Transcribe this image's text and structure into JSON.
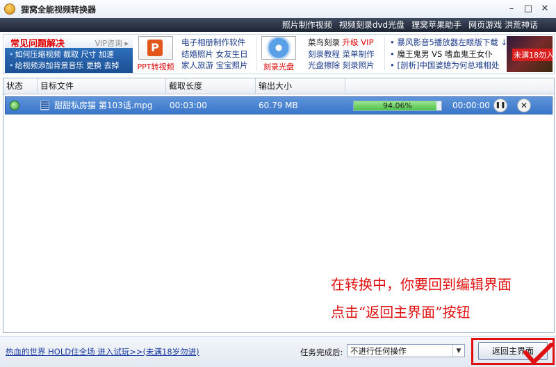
{
  "window": {
    "title": "狸窝全能视频转换器",
    "controls": [
      "–",
      "□",
      "✕"
    ]
  },
  "top_menu": [
    "照片制作视频",
    "视频刻录dvd光盘",
    "狸窝苹果助手",
    "网页游戏 洪荒神话"
  ],
  "banner": {
    "faq_title": "常见问题解决",
    "faq_vip": "VIP咨询 ▸",
    "faq_line1": "如何压缩视频 截取 尺寸 加速",
    "faq_line2": "给视频添加背景音乐 更换 去掉",
    "ppt_caption": "PPT转视频",
    "col1": [
      "电子相册制作软件",
      "结婚照片 女友生日",
      "家人旅游 宝宝照片"
    ],
    "disc_caption": "刻录光盘",
    "col2_line1_a": "菜鸟刻录",
    "col2_line1_b": "升级 VIP",
    "col2_line2": "刻录教程 菜单制作",
    "col2_line3": "光盘擦除 刻录照片",
    "col3_line1": "暴风影音5播放器左眼版下载 ↓",
    "col3_line2": "魔王鬼男 VS 嗜血鬼王女仆",
    "col3_line3": "[剖析]中国婆媳为何总难相处",
    "game_tag": "未满18勿入"
  },
  "table": {
    "headers": [
      "状态",
      "目标文件",
      "截取长度",
      "输出大小"
    ],
    "row": {
      "filename": "甜甜私房猫 第103话.mpg",
      "duration": "00:03:00",
      "size": "60.79 MB",
      "progress": 0.9406,
      "progress_text": "94.06%",
      "remaining": "00:00:00",
      "pause_symbol": "❚❚",
      "close_symbol": "✕"
    }
  },
  "annotation": {
    "line1": "在转换中，你要回到编辑界面",
    "line2": "点击“返回主界面”按钮"
  },
  "bottom": {
    "ad_link": "热血的世界 HOLD住全场 进入试玩>>(未满18岁勿进)",
    "done_label": "任务完成后:",
    "done_select": "不进行任何操作",
    "return_button": "返回主界面"
  },
  "colors": {
    "row_selected": "#4a84d0",
    "progress_fill": "#4dc24a",
    "annotation": "#e01010"
  }
}
